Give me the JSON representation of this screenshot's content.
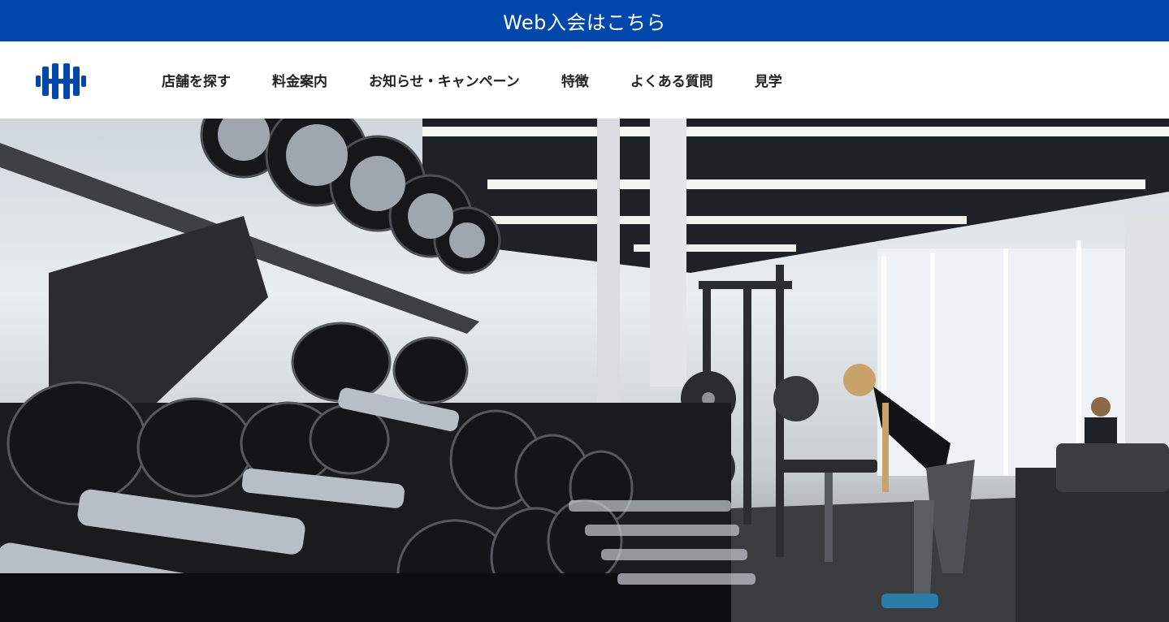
{
  "signup_bar": {
    "label": "Web入会はこちら"
  },
  "header": {
    "logo_icon": "dumbbell-icon",
    "nav": [
      {
        "label": "店舗を探す"
      },
      {
        "label": "料金案内"
      },
      {
        "label": "お知らせ・キャンペーン"
      },
      {
        "label": "特徴"
      },
      {
        "label": "よくある質問"
      },
      {
        "label": "見学"
      }
    ]
  },
  "hero": {
    "image": "gym-dumbbell-rack-photo"
  },
  "colors": {
    "brand": "#0047ab",
    "header_bg": "#ffffff",
    "nav_text": "#222222"
  }
}
